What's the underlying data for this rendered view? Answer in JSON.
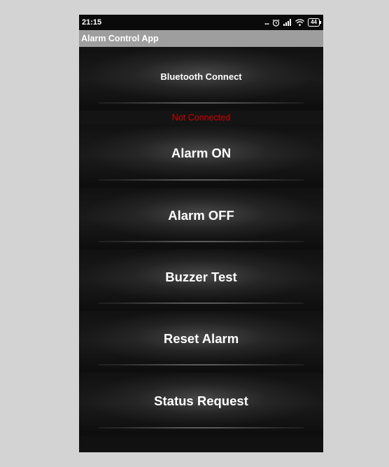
{
  "statusbar": {
    "time": "21:15",
    "dots": "...",
    "battery": "44"
  },
  "app": {
    "title": "Alarm Control App"
  },
  "bluetooth": {
    "button_label": "Bluetooth Connect",
    "status_text": "Not Connected",
    "status_color": "#d40000"
  },
  "controls": {
    "alarm_on": "Alarm ON",
    "alarm_off": "Alarm OFF",
    "buzzer_test": "Buzzer Test",
    "reset_alarm": "Reset Alarm",
    "status_request": "Status Request"
  },
  "icons": {
    "status": [
      "alarm-clock-icon",
      "signal-icon",
      "wifi-icon",
      "battery-icon"
    ]
  }
}
